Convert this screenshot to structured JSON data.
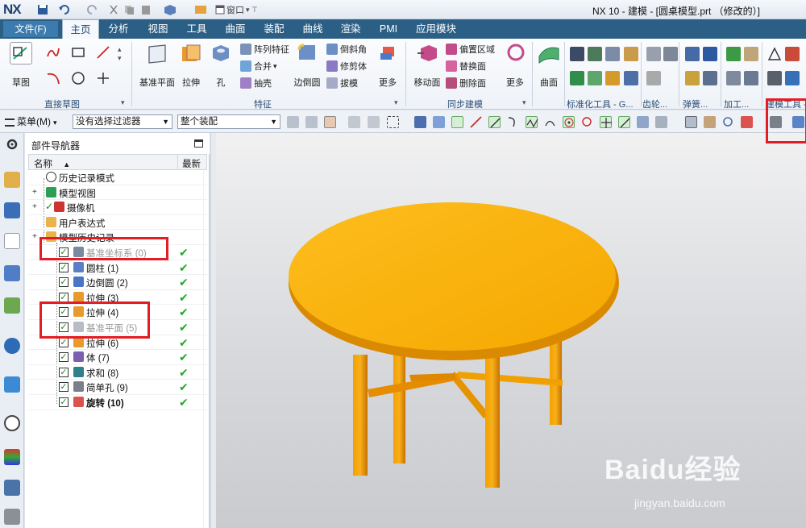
{
  "titlebar": {
    "logo": "NX",
    "window_menu": "窗口",
    "title": "NX 10 - 建模 - [圆桌模型.prt （修改的）]"
  },
  "tabs": {
    "file": "文件(F)",
    "items": [
      "主页",
      "分析",
      "视图",
      "工具",
      "曲面",
      "装配",
      "曲线",
      "渲染",
      "PMI",
      "应用模块"
    ],
    "active": "主页"
  },
  "ribbon": {
    "sketch": "草图",
    "group_direct_sketch": "直接草图",
    "datum_plane": "基准平面",
    "extrude": "拉伸",
    "hole": "孔",
    "pattern_feature": "阵列特征",
    "unite": "合并",
    "shell": "抽壳",
    "edge_blend": "边倒圆",
    "chamfer": "倒斜角",
    "trim_body": "修剪体",
    "draft": "拔模",
    "more1": "更多",
    "group_feature": "特征",
    "move_face": "移动面",
    "offset_region": "偏置区域",
    "replace_face": "替换面",
    "delete_face": "删除面",
    "more2": "更多",
    "group_sync": "同步建模",
    "surface": "曲面",
    "group_std": "标准化工具 - G...",
    "group_gear": "齿轮...",
    "group_spring": "弹簧...",
    "group_machining": "加工...",
    "group_modeling_tools": "建模工具 -"
  },
  "selection_bar": {
    "menu": "菜单(M)",
    "filter": "没有选择过滤器",
    "scope": "整个装配"
  },
  "navigator": {
    "title": "部件导航器",
    "col_name": "名称",
    "col_latest": "最新",
    "rows": [
      {
        "label": "历史记录模式",
        "style": "normal",
        "check": false,
        "latest": false
      },
      {
        "label": "模型视图",
        "style": "normal",
        "check": false,
        "latest": false
      },
      {
        "label": "摄像机",
        "style": "normal",
        "check": false,
        "latest": false
      },
      {
        "label": "用户表达式",
        "style": "normal",
        "check": false,
        "latest": false
      },
      {
        "label": "模型历史记录",
        "style": "normal",
        "check": false,
        "latest": false
      },
      {
        "label": "基准坐标系 (0)",
        "style": "gray",
        "check": true,
        "latest": true
      },
      {
        "label": "圆柱 (1)",
        "style": "normal",
        "check": true,
        "latest": true
      },
      {
        "label": "边倒圆 (2)",
        "style": "normal",
        "check": true,
        "latest": true
      },
      {
        "label": "拉伸 (3)",
        "style": "normal",
        "check": true,
        "latest": true
      },
      {
        "label": "拉伸 (4)",
        "style": "normal",
        "check": true,
        "latest": true
      },
      {
        "label": "基准平面 (5)",
        "style": "gray",
        "check": true,
        "latest": true
      },
      {
        "label": "拉伸 (6)",
        "style": "normal",
        "check": true,
        "latest": true
      },
      {
        "label": "体 (7)",
        "style": "normal",
        "check": true,
        "latest": true
      },
      {
        "label": "求和 (8)",
        "style": "normal",
        "check": true,
        "latest": true
      },
      {
        "label": "简单孔 (9)",
        "style": "normal",
        "check": true,
        "latest": true
      },
      {
        "label": "旋转 (10)",
        "style": "bold",
        "check": true,
        "latest": true
      }
    ]
  },
  "watermark": {
    "brand": "Baidu经验",
    "url": "jingyan.baidu.com"
  },
  "colors": {
    "tabbar": "#2c5f85",
    "table": "#f5ab00",
    "legs": "#f29b00",
    "highlight": "#e41c23"
  }
}
